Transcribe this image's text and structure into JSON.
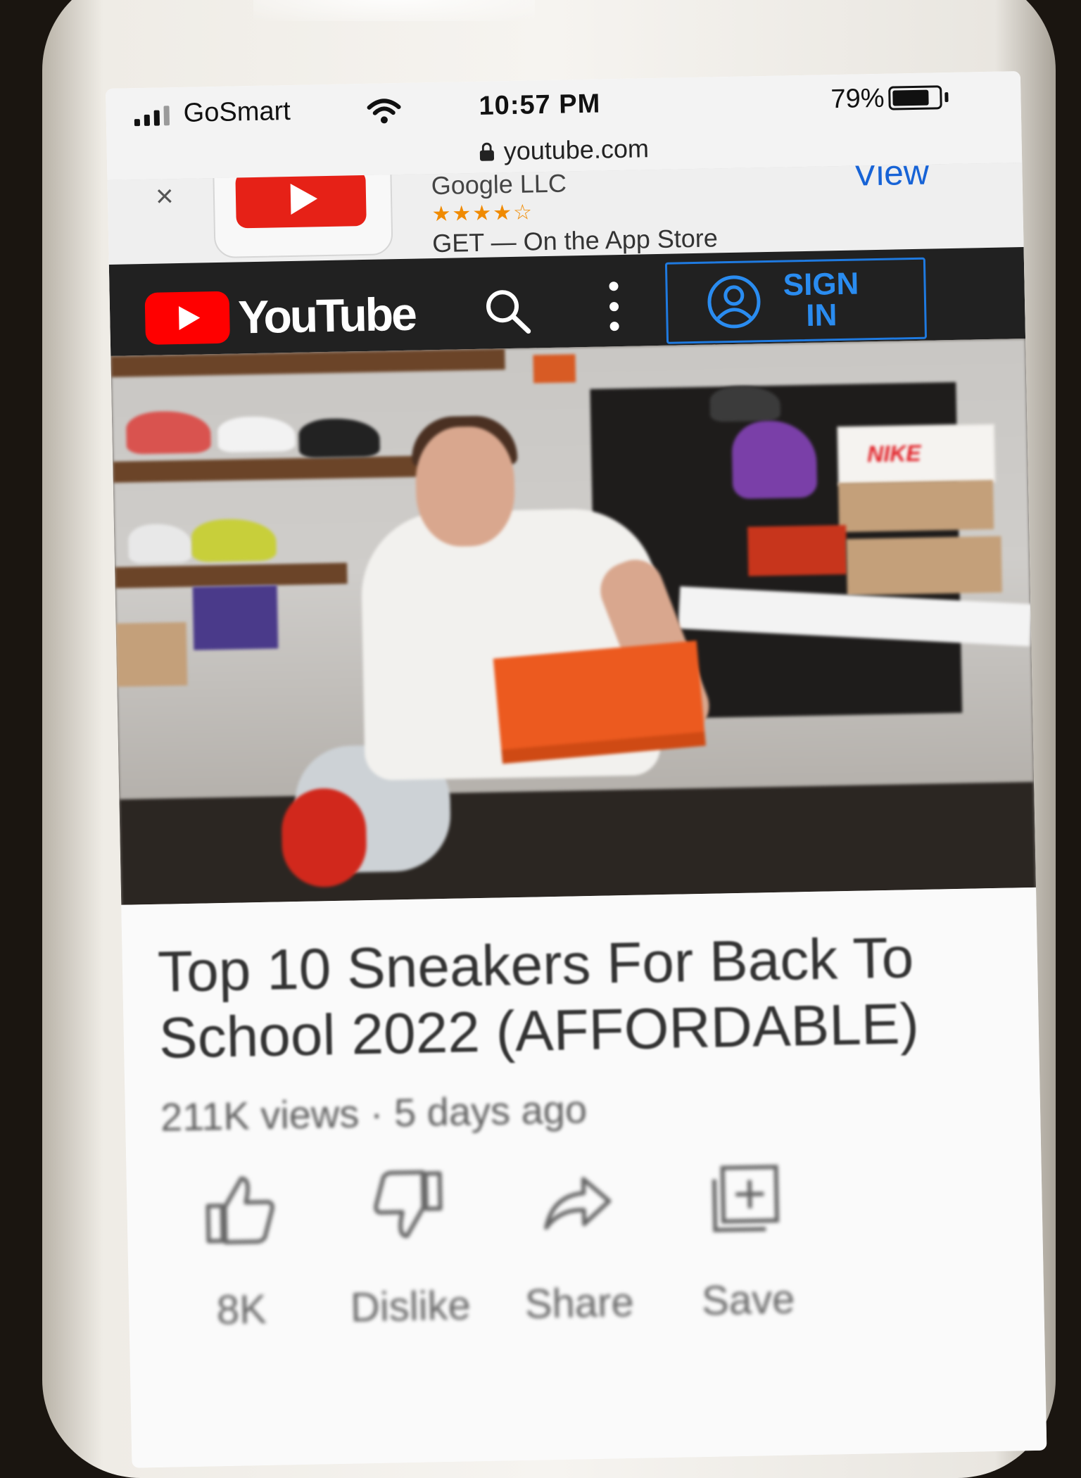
{
  "status_bar": {
    "carrier": "GoSmart",
    "time": "10:57 PM",
    "battery_percent_text": "79%",
    "battery_level": 0.79
  },
  "url_bar": {
    "domain": "youtube.com"
  },
  "app_banner": {
    "close_glyph": "×",
    "developer": "Google LLC",
    "rating_stars": "★★★★☆",
    "store_text": "GET — On the App Store",
    "view_label": "View"
  },
  "header": {
    "logo_text": "YouTube",
    "sign_in_label": "SIGN IN",
    "brand_color": "#ff0000",
    "accent_color": "#2a8cf0"
  },
  "video": {
    "title": "Top 10 Sneakers For Back To School 2022 (AFFORDABLE)",
    "meta": "211K views · 5 days ago",
    "box_brand": "NIKE"
  },
  "actions": [
    {
      "label": "8K",
      "icon": "thumbs-up-icon"
    },
    {
      "label": "Dislike",
      "icon": "thumbs-down-icon"
    },
    {
      "label": "Share",
      "icon": "share-icon"
    },
    {
      "label": "Save",
      "icon": "save-icon"
    }
  ]
}
